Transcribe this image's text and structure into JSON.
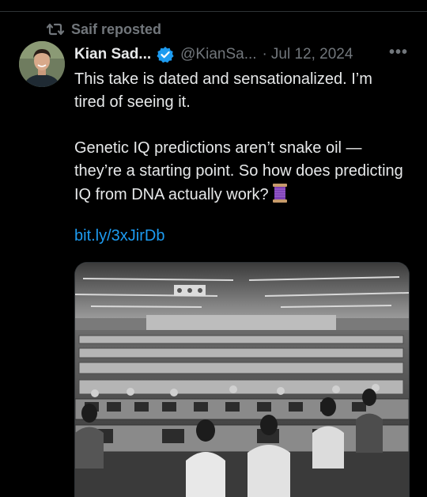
{
  "repost": {
    "label": "Saif reposted",
    "icon": "repost-icon"
  },
  "tweet": {
    "author_name": "Kian Sad...",
    "verified": true,
    "handle": "@KianSa...",
    "separator": "·",
    "date": "Jul 12, 2024",
    "more": "•••",
    "paragraph1": "This take is dated and sensationalized. I’m tired of seeing it.",
    "paragraph2": "Genetic IQ predictions aren’t snake oil — they’re a starting point. So how does predicting IQ from DNA actually work?",
    "emoji": "spool-of-thread-icon",
    "link": "bit.ly/3xJirDb"
  },
  "colors": {
    "background": "#000000",
    "text": "#e7e9ea",
    "muted": "#71767b",
    "link": "#1d9bf0",
    "verified": "#1d9bf0"
  }
}
